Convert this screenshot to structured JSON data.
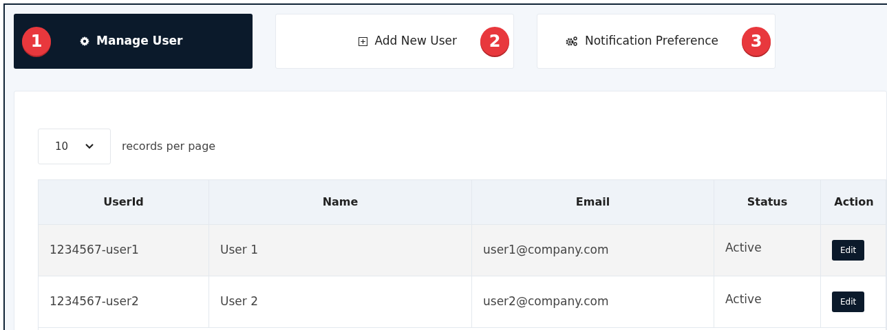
{
  "tabs": [
    {
      "label": "Manage User",
      "badge": "1",
      "selected": true
    },
    {
      "label": "Add New User",
      "badge": "2",
      "selected": false
    },
    {
      "label": "Notification Preference",
      "badge": "3",
      "selected": false
    }
  ],
  "page_size": {
    "value": "10",
    "label": "records per page"
  },
  "table": {
    "columns": [
      "UserId",
      "Name",
      "Email",
      "Status",
      "Action"
    ],
    "rows": [
      {
        "cells": [
          "1234567-user1",
          "User 1",
          "user1@company.com",
          "Active"
        ],
        "action": "Edit"
      },
      {
        "cells": [
          "1234567-user2",
          "User 2",
          "user2@company.com",
          "Active"
        ],
        "action": "Edit"
      }
    ]
  }
}
